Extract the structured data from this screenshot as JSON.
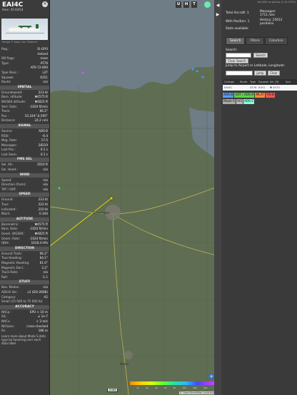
{
  "aircraft": {
    "hex": "EAI4C",
    "sub": "Hex: 4CA454",
    "photo_credit": "Image © Kaan Can Özdemir"
  },
  "info": [
    {
      "k": "Reg.:",
      "v": "EI-GPO"
    },
    {
      "k": "",
      "v": "Ireland"
    },
    {
      "k": "DB flags:",
      "v": "none"
    },
    {
      "k": "Type:",
      "v": "AT76"
    },
    {
      "k": "",
      "v": "ATR-72-600"
    },
    {
      "k": "Type Desc.:",
      "v": "L2T"
    },
    {
      "k": "Squawk:",
      "v": "6351"
    },
    {
      "k": "Route:",
      "v": "n/a"
    }
  ],
  "spatial_title": "SPATIAL",
  "spatial": [
    {
      "k": "Groundspeed:",
      "v": "223 kt"
    },
    {
      "k": "Baro. altitude:",
      "v": "▼4575 ft"
    },
    {
      "k": "WGS84 altitude:",
      "v": "▼4825 ft"
    },
    {
      "k": "Vert. Rate:",
      "v": "-1024 ft/min"
    },
    {
      "k": "Track:",
      "v": "66.2°"
    },
    {
      "k": "Pos.:",
      "v": "53.244°,6.595°"
    },
    {
      "k": "Distance:",
      "v": "24.2 nmi"
    }
  ],
  "signal_title": "SIGNAL",
  "signal": [
    {
      "k": "Source:",
      "v": "ADS-B"
    },
    {
      "k": "RSSI:",
      "v": "-6.4"
    },
    {
      "k": "Msg. Rate:",
      "v": "17.5"
    },
    {
      "k": "Messages:",
      "v": "28210"
    },
    {
      "k": "Last Pos.:",
      "v": "0.1 s"
    },
    {
      "k": "Last Seen:",
      "v": "0.1 s"
    }
  ],
  "fms_title": "FMS SEL",
  "fms": [
    {
      "k": "Sel. Alt.:",
      "v": "2016 ft"
    },
    {
      "k": "Sel. Head.:",
      "v": "n/a"
    }
  ],
  "wind_title": "WIND",
  "wind": [
    {
      "k": "Speed:",
      "v": "n/a"
    },
    {
      "k": "Direction (from):",
      "v": "n/a"
    },
    {
      "k": "TAT / OAT:",
      "v": "n/a"
    }
  ],
  "speed_title": "SPEED",
  "speed": [
    {
      "k": "Ground:",
      "v": "223 kt"
    },
    {
      "k": "True:",
      "v": "222 kt"
    },
    {
      "k": "Indicated:",
      "v": "210 kt"
    },
    {
      "k": "Mach:",
      "v": "0.344"
    }
  ],
  "altitude_title": "ALTITUDE",
  "altitude": [
    {
      "k": "Barometric:",
      "v": "▼4575 ft"
    },
    {
      "k": "Baro. Rate:",
      "v": "-1024 ft/min"
    },
    {
      "k": "Geom. WGS84:",
      "v": "▼4825 ft"
    },
    {
      "k": "Geom. Rate:",
      "v": "-1024 ft/min"
    },
    {
      "k": "QNH:",
      "v": "1018.4 hPa"
    }
  ],
  "direction_title": "DIRECTION",
  "direction": [
    {
      "k": "Ground Track:",
      "v": "66.2°"
    },
    {
      "k": "True Heading:",
      "v": "64.1°"
    },
    {
      "k": "Magnetic Heading:",
      "v": "61.0°"
    },
    {
      "k": "Magnetic Decl.:",
      "v": "3.2°"
    },
    {
      "k": "Track Rate:",
      "v": "n/a"
    },
    {
      "k": "Roll:",
      "v": "-1.1"
    }
  ],
  "stuff_title": "STUFF",
  "stuff": [
    {
      "k": "Nav. Modes:",
      "v": "n/a"
    },
    {
      "k": "ADS-B Ver.:",
      "v": "v2 (DO-260B)"
    },
    {
      "k": "Category:",
      "v": "A2"
    },
    {
      "k": "Small (15 500 to 75 000 lb)",
      "v": ""
    }
  ],
  "accuracy_title": "ACCURACY",
  "accuracy": [
    {
      "k": "NACp:",
      "v": "EPU < 10 m"
    },
    {
      "k": "SIL:",
      "v": "≤ 1e-7"
    },
    {
      "k": "NACv:",
      "v": "< 3 m/s"
    },
    {
      "k": "NICbaro:",
      "v": "cross-checked"
    },
    {
      "k": "Rc:",
      "v": "186 m"
    }
  ],
  "footer_note": "Learn more about Mode S data type by hovering over each data label.",
  "map": {
    "top_buttons": [
      "U",
      "H",
      "T"
    ],
    "side_buttons": [
      "O",
      "L",
      "K",
      "M",
      "P",
      "I",
      "R"
    ],
    "nav_arrows": [
      "◀",
      "▶"
    ],
    "scale": "5 NM",
    "city": "Groningen",
    "town2": "Assen",
    "osm": "© OpenStreetMap contributors.",
    "colorbar_ticks": [
      "",
      "1k",
      "2k",
      "4k",
      "6k",
      "8k",
      "10k",
      "20k",
      "30k",
      "40k+"
    ],
    "zoom_in": "+",
    "zoom_out": "−"
  },
  "right": {
    "link": "tar1090 on github (3.14.1702)",
    "total_label": "Total Aircraft:",
    "total_value": "1",
    "position_label": "With Position:",
    "position_value": "1",
    "messages_label": "Messages:",
    "messages_value": "1711 /sec",
    "history_label": "History:",
    "history_value": "25612 positions",
    "stats_label": "Stats available",
    "tabs": [
      "Search",
      "Filters",
      "Columns"
    ],
    "search_label": "Search:",
    "search_button": "Search",
    "clear_button": "Clear Search",
    "jump_label": "Jump to Airport or Latitude, Longitude:",
    "jump_button": "Jump",
    "jump_clear": "Clear",
    "columns": [
      "Callsign",
      "Route",
      "Type",
      "Squawk",
      "Alt. (ft)",
      "Spd"
    ],
    "row": [
      "EAI4C",
      "",
      "AT76",
      "6351",
      "▼ 4575",
      ""
    ],
    "legend": [
      {
        "label": "ADS-B",
        "color": "#5b9cf2"
      },
      {
        "label": "UAT / ADS-R",
        "color": "#5dd24a"
      },
      {
        "label": "MLAT",
        "color": "#ff8a3d"
      },
      {
        "label": "TIS-B",
        "color": "#f55"
      },
      {
        "label": "Mode-S",
        "color": "#aaa"
      },
      {
        "label": "AIS",
        "color": "#bbb"
      },
      {
        "label": "ADS-C",
        "color": "#8fd"
      }
    ]
  }
}
